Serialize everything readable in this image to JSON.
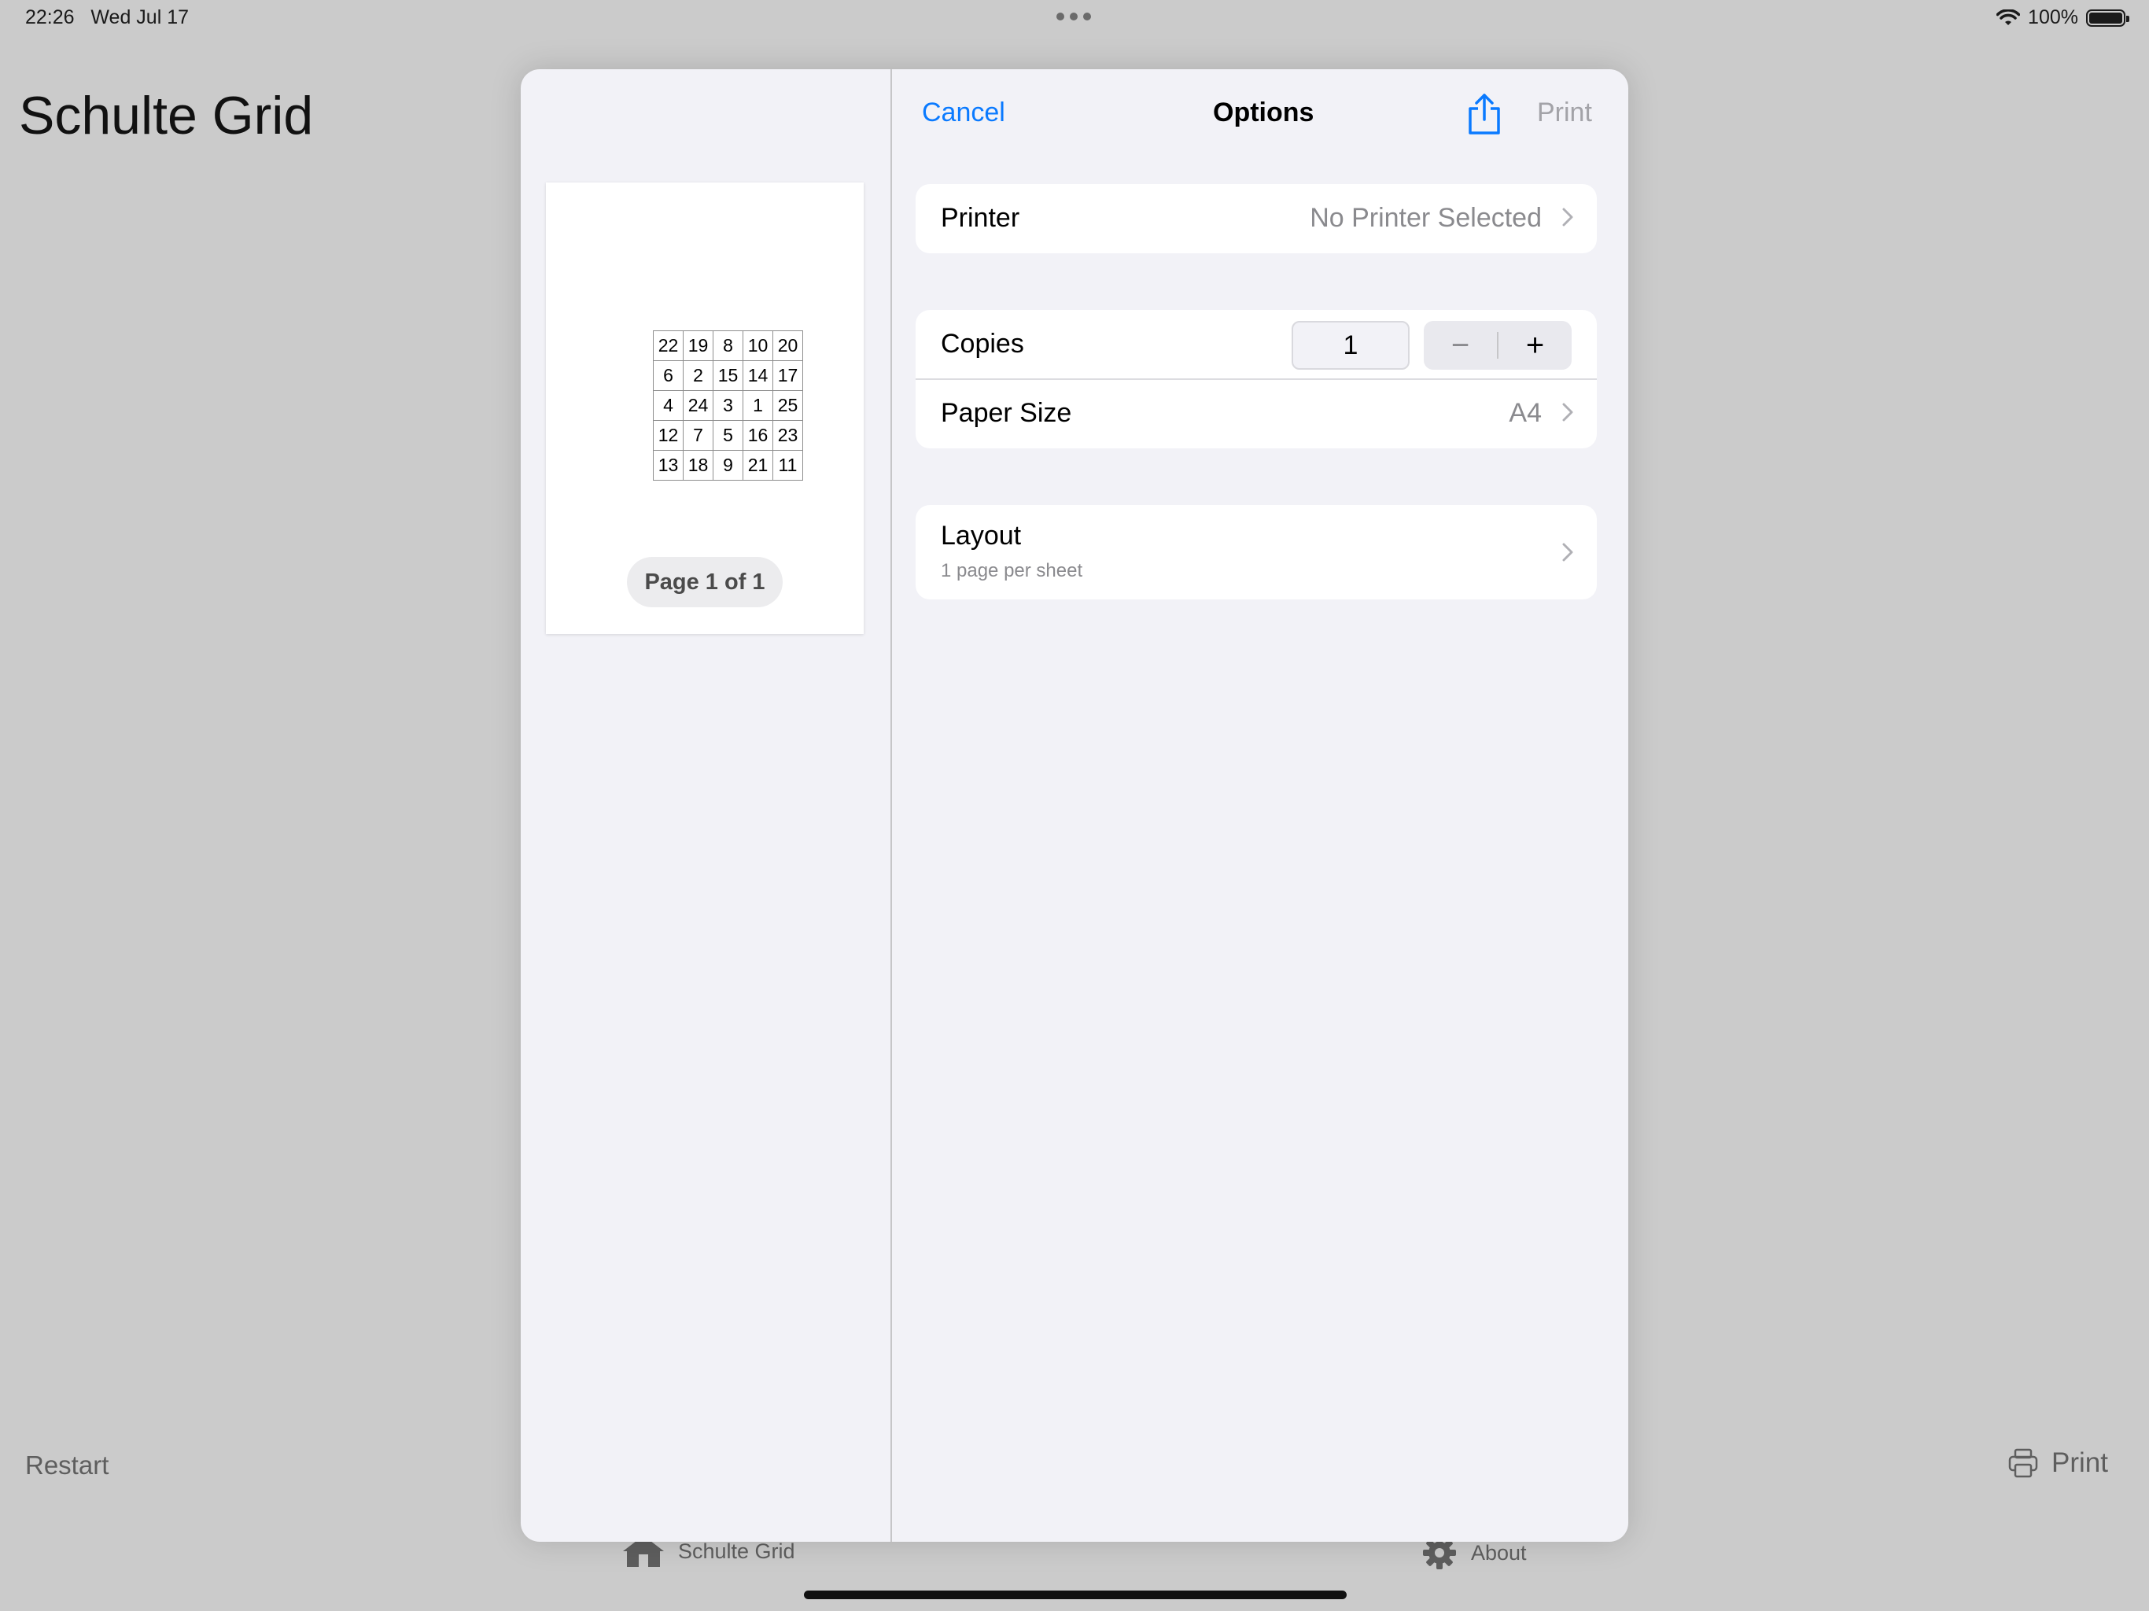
{
  "status_bar": {
    "time": "22:26",
    "date": "Wed Jul 17",
    "battery": "100%"
  },
  "background_app": {
    "title": "Schulte Grid",
    "restart_label": "Restart",
    "print_label": "Print",
    "tabs": [
      {
        "label": "Schulte Grid",
        "icon": "house-icon"
      },
      {
        "label": "About",
        "icon": "gear-icon"
      }
    ]
  },
  "print_dialog": {
    "cancel_label": "Cancel",
    "title": "Options",
    "print_label": "Print",
    "preview": {
      "grid": [
        [
          "22",
          "19",
          "8",
          "10",
          "20"
        ],
        [
          "6",
          "2",
          "15",
          "14",
          "17"
        ],
        [
          "4",
          "24",
          "3",
          "1",
          "25"
        ],
        [
          "12",
          "7",
          "5",
          "16",
          "23"
        ],
        [
          "13",
          "18",
          "9",
          "21",
          "11"
        ]
      ],
      "page_indicator": "Page 1 of 1"
    },
    "printer": {
      "label": "Printer",
      "value": "No Printer Selected"
    },
    "copies": {
      "label": "Copies",
      "value": "1",
      "decrement": "−",
      "increment": "+"
    },
    "paper_size": {
      "label": "Paper Size",
      "value": "A4"
    },
    "layout": {
      "label": "Layout",
      "subtitle": "1 page per sheet"
    }
  },
  "colors": {
    "accent": "#0a7aff",
    "disabled": "#a3a3a8",
    "secondary_text": "#8a8a8e",
    "dim_background": "#cbcbcb",
    "sheet_background": "#f2f2f7"
  }
}
